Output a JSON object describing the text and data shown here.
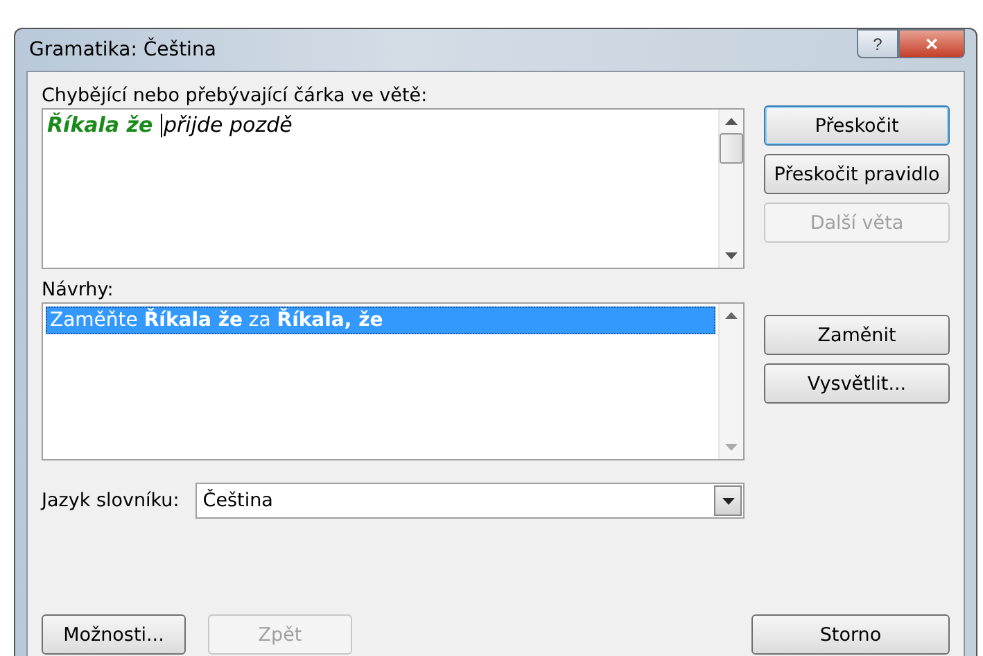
{
  "window": {
    "title": "Gramatika: Čeština",
    "help": "?",
    "close": "✕"
  },
  "error": {
    "label": "Chybějící nebo přebývající čárka ve větě:",
    "parts": [
      {
        "kind": "error",
        "text": "Říkala že"
      },
      {
        "kind": "normal",
        "text": "přijde pozdě"
      }
    ]
  },
  "side_buttons": [
    {
      "label": "Přeskočit",
      "default": true,
      "disabled": false
    },
    {
      "label": "Přeskočit pravidlo",
      "default": false,
      "disabled": false
    },
    {
      "label": "Další věta",
      "default": false,
      "disabled": true
    }
  ],
  "suggestions": {
    "label": "Návrhy:",
    "items": [
      {
        "text": "Zaměňte  **Říkala že**  za  **Říkala, že**",
        "selected": true
      }
    ]
  },
  "suggestion_buttons": [
    {
      "label": "Zaměnit",
      "default": false,
      "disabled": false
    },
    {
      "label": "Vysvětlit...",
      "default": false,
      "disabled": false
    }
  ],
  "language": {
    "label": "Jazyk slovníku:",
    "value": "Čeština"
  },
  "bottom_buttons": [
    {
      "label": "Možnosti...",
      "default": false,
      "disabled": false
    },
    {
      "label": "Zpět",
      "default": false,
      "disabled": true
    },
    {
      "label": "Storno",
      "default": false,
      "disabled": false
    }
  ]
}
